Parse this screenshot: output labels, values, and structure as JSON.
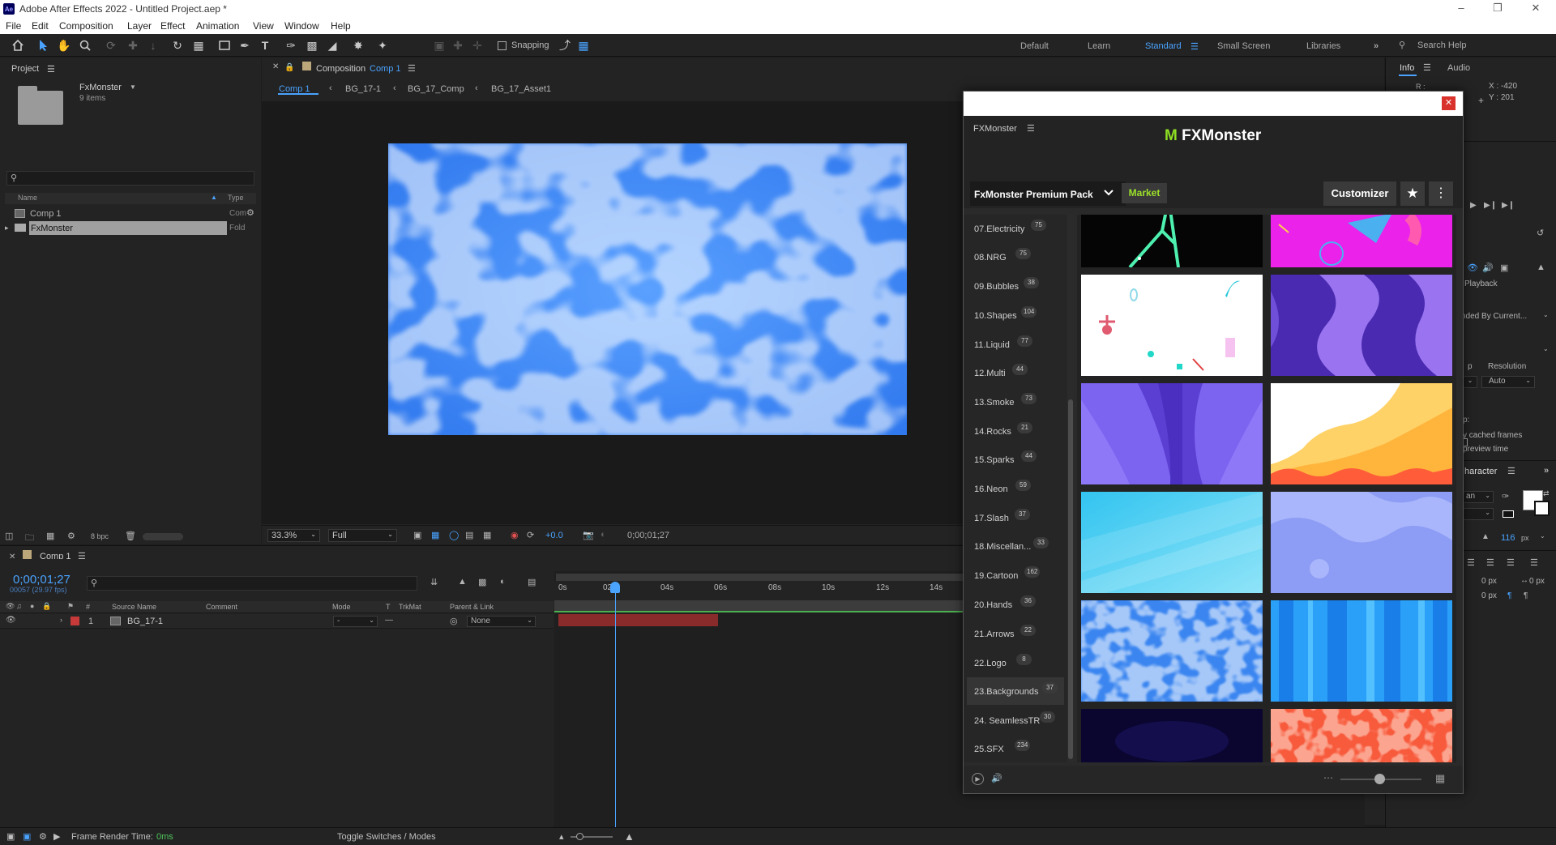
{
  "window": {
    "title": "Adobe After Effects 2022 - Untitled Project.aep *",
    "app_logo": "Ae"
  },
  "menu": [
    "File",
    "Edit",
    "Composition",
    "Layer",
    "Effect",
    "Animation",
    "View",
    "Window",
    "Help"
  ],
  "toolbar": {
    "snapping_label": "Snapping",
    "workspaces": [
      "Default",
      "Learn",
      "Standard",
      "Small Screen",
      "Libraries"
    ],
    "active_workspace": "Standard",
    "search_help_placeholder": "Search Help"
  },
  "project": {
    "tab_label": "Project",
    "folder_name": "FxMonster",
    "items_count": "9 items",
    "columns": {
      "name": "Name",
      "type": "Type"
    },
    "rows": [
      {
        "name": "Comp 1",
        "type": "Com"
      },
      {
        "name": "FxMonster",
        "type": "Fold"
      }
    ],
    "bpc": "8 bpc"
  },
  "composition": {
    "tab_prefix": "Composition",
    "tab_comp": "Comp 1",
    "breadcrumbs": [
      "Comp 1",
      "BG_17-1",
      "BG_17_Comp",
      "BG_17_Asset1"
    ],
    "zoom": "33.3%",
    "resolution": "Full",
    "exposure": "+0.0",
    "timecode": "0;00;01;27"
  },
  "timeline": {
    "tab_label": "Comp 1",
    "timecode": "0;00;01;27",
    "frame_info": "00057 (29.97 fps)",
    "columns": [
      "#",
      "Source Name",
      "Comment",
      "Mode",
      "T",
      "TrkMat",
      "Parent & Link"
    ],
    "layer": {
      "index": "1",
      "name": "BG_17-1",
      "mode": "-",
      "trkmat": "—",
      "parent": "None"
    },
    "ruler": [
      "0s",
      "02s",
      "04s",
      "06s",
      "08s",
      "10s",
      "12s",
      "14s"
    ],
    "frame_render_label": "Frame Render Time:",
    "frame_render_value": "0ms",
    "toggle_label": "Toggle Switches / Modes"
  },
  "right_panel": {
    "tabs": [
      "Info",
      "Audio"
    ],
    "info_x": "X : -420",
    "info_y": "Y : 201",
    "info_r": "R :",
    "playback_label": "Playback",
    "ended_by": "nded By Current...",
    "resolution_label": "Resolution",
    "resolution_value": "Auto",
    "cache_line1": "p:",
    "cache_line2": "y cached frames",
    "cache_line3": "preview time",
    "character_tab": "haracter",
    "font_partial": "an",
    "font_size": "116",
    "font_unit": "px",
    "px_a": "0 px",
    "px_b": "0 px",
    "px_c": "0 px",
    "px_d": "0 px"
  },
  "fxmonster": {
    "panel_title": "FXMonster",
    "logo_m": "M",
    "logo_text": "FXMonster",
    "pack_name": "FxMonster Premium Pack",
    "market_label": "Market",
    "customizer_label": "Customizer",
    "categories": [
      {
        "label": "07.Electricity",
        "count": "75"
      },
      {
        "label": "08.NRG",
        "count": "75"
      },
      {
        "label": "09.Bubbles",
        "count": "38"
      },
      {
        "label": "10.Shapes",
        "count": "104"
      },
      {
        "label": "11.Liquid",
        "count": "77"
      },
      {
        "label": "12.Multi",
        "count": "44"
      },
      {
        "label": "13.Smoke",
        "count": "73"
      },
      {
        "label": "14.Rocks",
        "count": "21"
      },
      {
        "label": "15.Sparks",
        "count": "44"
      },
      {
        "label": "16.Neon",
        "count": "59"
      },
      {
        "label": "17.Slash",
        "count": "37"
      },
      {
        "label": "18.Miscellan...",
        "count": "33"
      },
      {
        "label": "19.Cartoon",
        "count": "162"
      },
      {
        "label": "20.Hands",
        "count": "36"
      },
      {
        "label": "21.Arrows",
        "count": "22"
      },
      {
        "label": "22.Logo",
        "count": "8"
      },
      {
        "label": "23.Backgrounds",
        "count": "37"
      },
      {
        "label": "24. SeamlessTR",
        "count": "30"
      },
      {
        "label": "25.SFX",
        "count": "234"
      }
    ],
    "active_category": "23.Backgrounds"
  }
}
